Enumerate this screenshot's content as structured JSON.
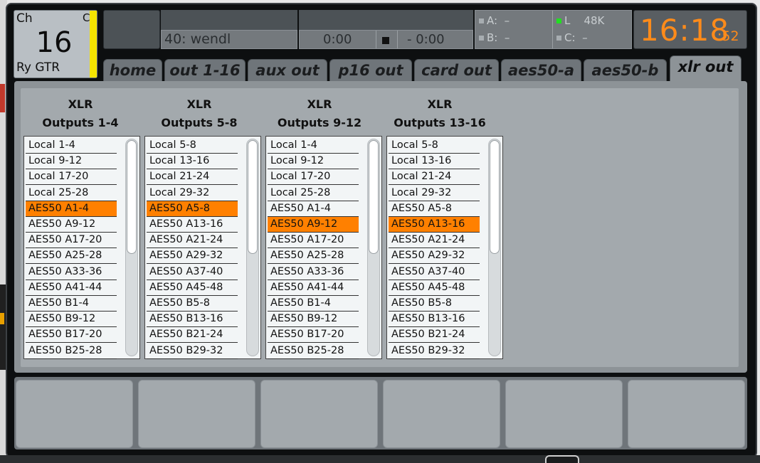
{
  "channel": {
    "label": "Ch",
    "corner": "C",
    "number": "16",
    "name": "Ry GTR",
    "color": "#f5e400"
  },
  "scene": {
    "name": "40: wendl"
  },
  "transport": {
    "elapsed": "0:00",
    "remaining": "- 0:00"
  },
  "status": {
    "a_label": "A:",
    "a_value": "–",
    "b_label": "B:",
    "b_value": "–",
    "l_label": "L",
    "rate": "48K",
    "c_label": "C:",
    "c_value": "–"
  },
  "clock": {
    "hm": "16:18",
    "sec": ":52",
    "color": "#ff8b1a"
  },
  "tabs": [
    "home",
    "out 1-16",
    "aux out",
    "p16 out",
    "card out",
    "aes50-a",
    "aes50-b",
    "xlr out"
  ],
  "active_tab": "xlr out",
  "columns": [
    {
      "head1": "XLR",
      "head2": "Outputs 1-4",
      "items": [
        "Local 1-4",
        "Local 9-12",
        "Local 17-20",
        "Local 25-28",
        "AES50 A1-4",
        "AES50 A9-12",
        "AES50 A17-20",
        "AES50 A25-28",
        "AES50 A33-36",
        "AES50 A41-44",
        "AES50 B1-4",
        "AES50 B9-12",
        "AES50 B17-20",
        "AES50 B25-28"
      ],
      "selected": "AES50 A1-4"
    },
    {
      "head1": "XLR",
      "head2": "Outputs 5-8",
      "items": [
        "Local 5-8",
        "Local 13-16",
        "Local 21-24",
        "Local 29-32",
        "AES50 A5-8",
        "AES50 A13-16",
        "AES50 A21-24",
        "AES50 A29-32",
        "AES50 A37-40",
        "AES50 A45-48",
        "AES50 B5-8",
        "AES50 B13-16",
        "AES50 B21-24",
        "AES50 B29-32"
      ],
      "selected": "AES50 A5-8"
    },
    {
      "head1": "XLR",
      "head2": "Outputs 9-12",
      "items": [
        "Local 1-4",
        "Local 9-12",
        "Local 17-20",
        "Local 25-28",
        "AES50 A1-4",
        "AES50 A9-12",
        "AES50 A17-20",
        "AES50 A25-28",
        "AES50 A33-36",
        "AES50 A41-44",
        "AES50 B1-4",
        "AES50 B9-12",
        "AES50 B17-20",
        "AES50 B25-28"
      ],
      "selected": "AES50 A9-12"
    },
    {
      "head1": "XLR",
      "head2": "Outputs 13-16",
      "items": [
        "Local 5-8",
        "Local 13-16",
        "Local 21-24",
        "Local 29-32",
        "AES50 A5-8",
        "AES50 A13-16",
        "AES50 A21-24",
        "AES50 A29-32",
        "AES50 A37-40",
        "AES50 A45-48",
        "AES50 B5-8",
        "AES50 B13-16",
        "AES50 B21-24",
        "AES50 B29-32"
      ],
      "selected": "AES50 A13-16"
    }
  ],
  "selection_color": "#ff8000"
}
